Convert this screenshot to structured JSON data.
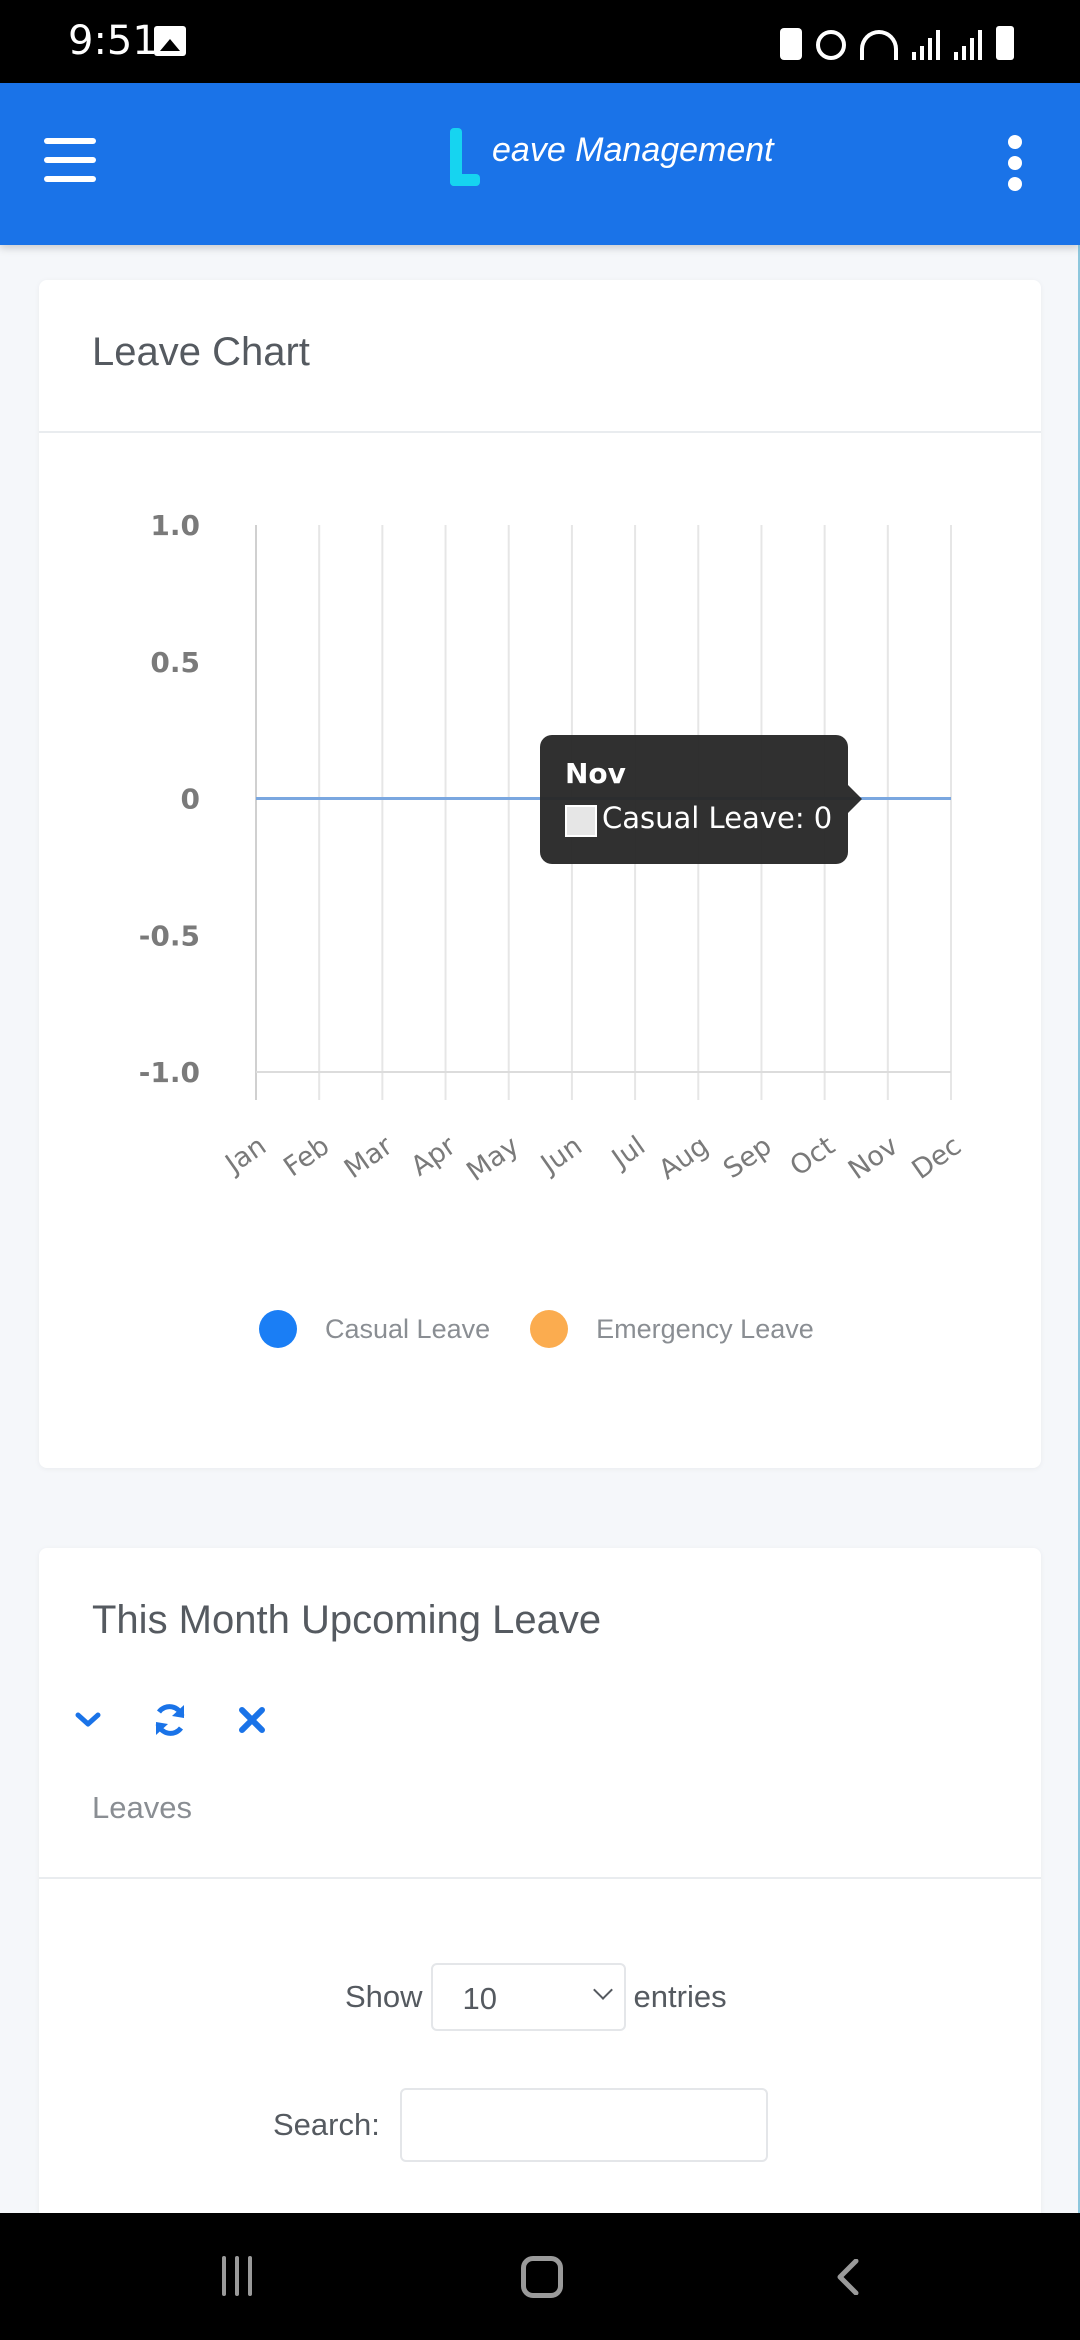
{
  "status_bar": {
    "time": "9:51",
    "left_icons": [
      "gallery-icon"
    ],
    "right_icons": [
      "battery-saver-icon",
      "alarm-icon",
      "wifi-icon",
      "signal-icon",
      "signal-icon",
      "battery-charging-icon"
    ]
  },
  "app_bar": {
    "logo_letter": "L",
    "title": "eave Management",
    "menu_icon": "hamburger-icon",
    "more_icon": "more-vertical-icon",
    "brand_color": "#1a73e8",
    "logo_color": "#16d4f0"
  },
  "leave_chart_card": {
    "title": "Leave Chart"
  },
  "chart_data": {
    "type": "line",
    "title": "Leave Chart",
    "xlabel": "",
    "ylabel": "",
    "categories": [
      "Jan",
      "Feb",
      "Mar",
      "Apr",
      "May",
      "Jun",
      "Jul",
      "Aug",
      "Sep",
      "Oct",
      "Nov",
      "Dec"
    ],
    "series": [
      {
        "name": "Casual Leave",
        "color": "#1a7ef5",
        "values": [
          0,
          0,
          0,
          0,
          0,
          0,
          0,
          0,
          0,
          0,
          0,
          0
        ]
      },
      {
        "name": "Emergency Leave",
        "color": "#fbac4f",
        "values": []
      }
    ],
    "ylim": [
      -1.0,
      1.0
    ],
    "yticks": [
      "1.0",
      "0.5",
      "0",
      "-0.5",
      "-1.0"
    ],
    "ytick_values": [
      1.0,
      0.5,
      0,
      -0.5,
      -1.0
    ],
    "grid": "vertical",
    "legend": "bottom",
    "tooltip": {
      "title": "Nov",
      "label": "Casual Leave: 0",
      "category": "Nov"
    }
  },
  "upcoming_card": {
    "title": "This Month Upcoming Leave",
    "tools": [
      "chevron-down-icon",
      "refresh-icon",
      "close-icon"
    ],
    "subtitle": "Leaves",
    "show_label": "Show",
    "entries_value": "10",
    "entries_label": "entries",
    "search_label": "Search:",
    "search_value": "",
    "accent_color": "#1a73e8"
  },
  "nav_bar": {
    "buttons": [
      "recents-icon",
      "home-icon",
      "back-icon"
    ]
  }
}
